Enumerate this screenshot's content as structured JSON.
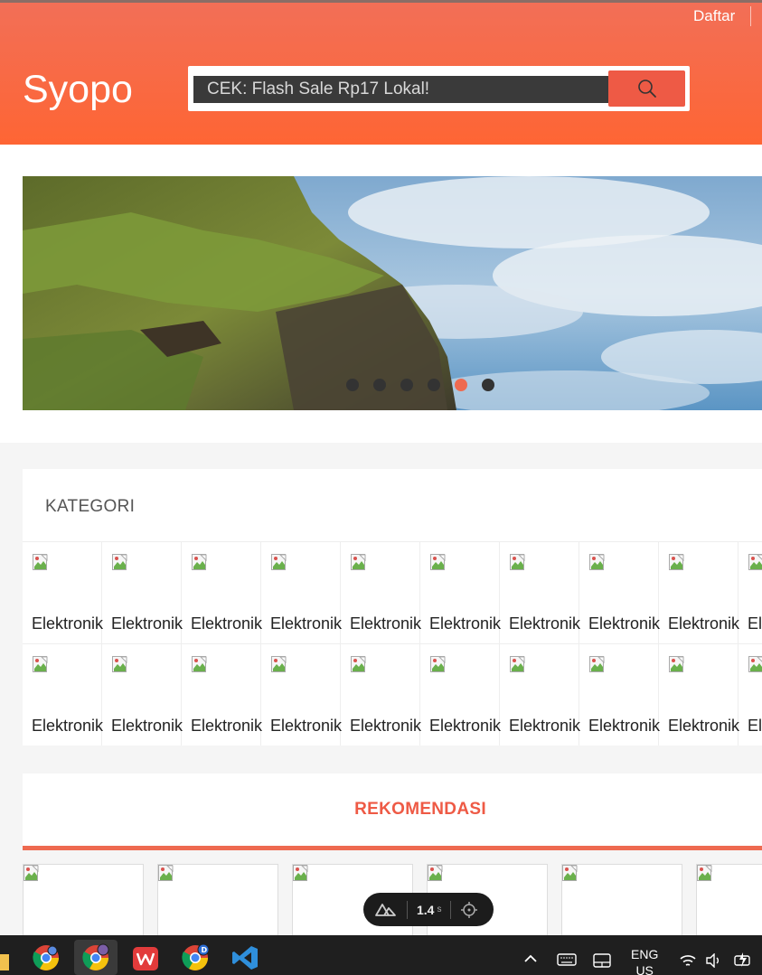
{
  "header": {
    "register_link": "Daftar",
    "logo": "Syopo",
    "search_placeholder": "CEK: Flash Sale Rp17 Lokal!",
    "brand_color": "#fe6534",
    "accent_color": "#ee5a45"
  },
  "carousel": {
    "dot_count": 6,
    "active_index": 4
  },
  "kategori": {
    "title": "KATEGORI",
    "rows": [
      [
        "Elektronik",
        "Elektronik",
        "Elektronik",
        "Elektronik",
        "Elektronik",
        "Elektronik",
        "Elektronik",
        "Elektronik",
        "Elektronik",
        "Elektronik"
      ],
      [
        "Elektronik",
        "Elektronik",
        "Elektronik",
        "Elektronik",
        "Elektronik",
        "Elektronik",
        "Elektronik",
        "Elektronik",
        "Elektronik",
        "Elektronik"
      ]
    ]
  },
  "rekomendasi": {
    "title": "REKOMENDASI",
    "product_count": 6
  },
  "devtools_overlay": {
    "value": "1.4",
    "unit": "s"
  },
  "taskbar": {
    "language": "ENG",
    "region": "US",
    "apps": [
      "file-explorer-icon",
      "chrome-icon",
      "chrome-profile-icon",
      "wps-office-icon",
      "chrome-d-icon",
      "vscode-icon"
    ]
  }
}
